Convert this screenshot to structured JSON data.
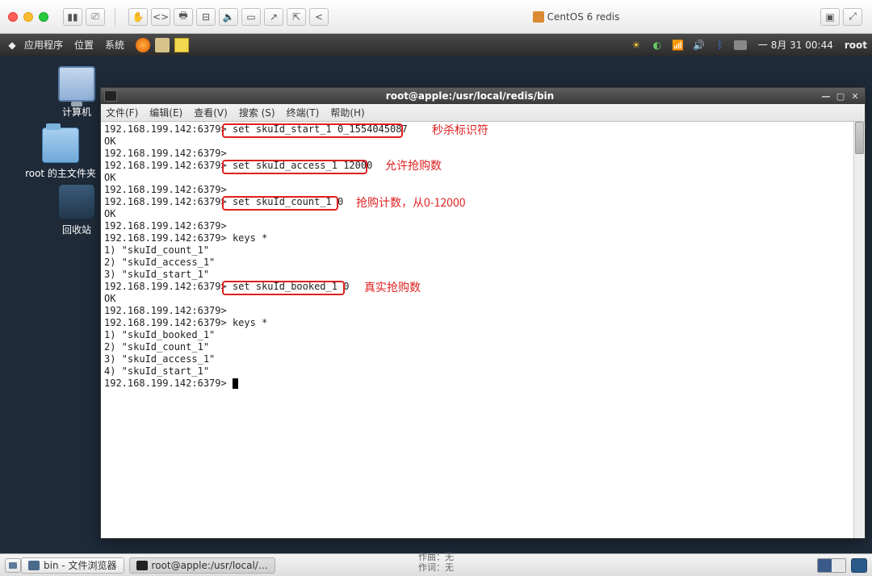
{
  "mactop": {
    "title": "CentOS 6 redis"
  },
  "panel": {
    "apps": "应用程序",
    "places": "位置",
    "system": "系统",
    "clock": "一 8月 31 00:44",
    "user": "root"
  },
  "desktop": {
    "computer": "计算机",
    "home": "root 的主文件夹",
    "trash": "回收站"
  },
  "terminal": {
    "title": "root@apple:/usr/local/redis/bin",
    "menu": {
      "file": "文件(F)",
      "edit": "编辑(E)",
      "view": "查看(V)",
      "search": "搜索 (S)",
      "terminal": "终端(T)",
      "help": "帮助(H)"
    },
    "prompt": "192.168.199.142:6379>",
    "lines": [
      "192.168.199.142:6379> set skuId_start_1 0_1554045087",
      "OK",
      "192.168.199.142:6379>",
      "192.168.199.142:6379> set skuId_access_1 12000",
      "OK",
      "192.168.199.142:6379>",
      "192.168.199.142:6379> set skuId_count_1 0",
      "OK",
      "192.168.199.142:6379>",
      "192.168.199.142:6379> keys *",
      "1) \"skuId_count_1\"",
      "2) \"skuId_access_1\"",
      "3) \"skuId_start_1\"",
      "192.168.199.142:6379> set skuId_booked_1 0",
      "OK",
      "192.168.199.142:6379>",
      "192.168.199.142:6379> keys *",
      "1) \"skuId_booked_1\"",
      "2) \"skuId_count_1\"",
      "3) \"skuId_access_1\"",
      "4) \"skuId_start_1\"",
      "192.168.199.142:6379> "
    ],
    "commands": {
      "c1": "set skuId_start_1 0_1554045087",
      "c2": "set skuId_access_1 12000",
      "c3": "set skuId_count_1 0",
      "c4": "set skuId_booked_1 0"
    }
  },
  "annotations": {
    "a1": "秒杀标识符",
    "a2": "允许抢购数",
    "a3": "抢购计数，从0-12000",
    "a4": "真实抢购数"
  },
  "bottom": {
    "task1": "bin - 文件浏览器",
    "task2": "root@apple:/usr/local/…",
    "music": "作曲：无\n作词：无"
  }
}
